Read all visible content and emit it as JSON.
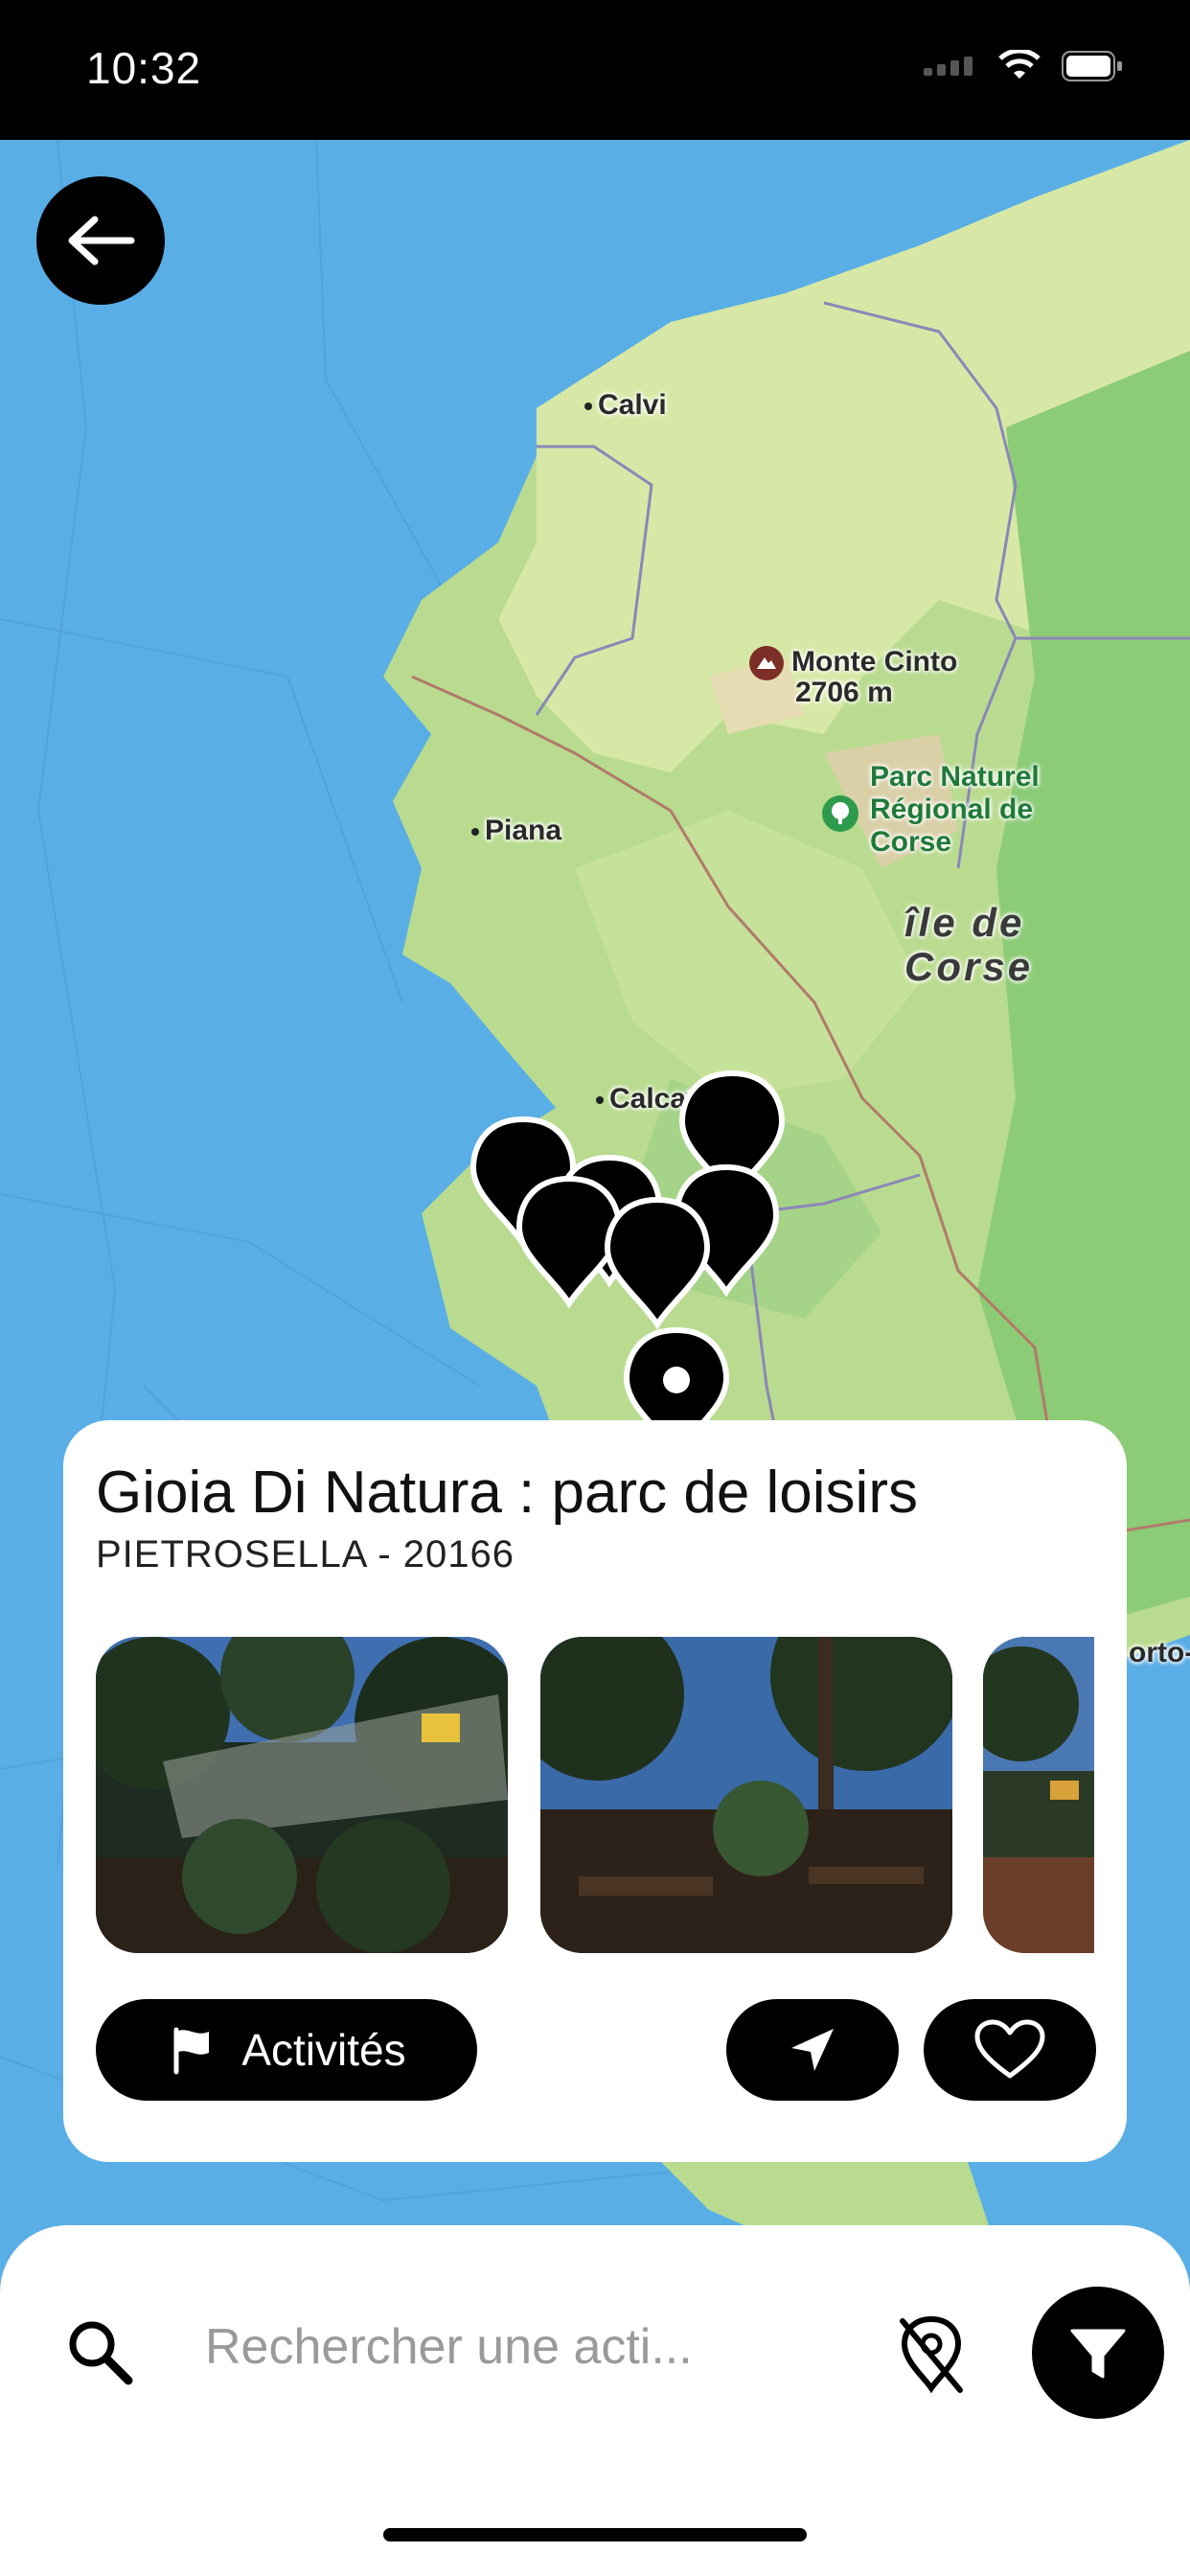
{
  "status_bar": {
    "time": "10:32"
  },
  "map": {
    "labels": {
      "calvi": "Calvi",
      "monte_cinto": "Monte Cinto",
      "monte_cinto_alt": "2706 m",
      "parc_line1": "Parc Naturel",
      "parc_line2": "Régional de",
      "parc_line3": "Corse",
      "piana": "Piana",
      "ile_line1": "île de",
      "ile_line2": "Corse",
      "calcatoggio": "Calcatoggio",
      "porto": "orto-"
    }
  },
  "card": {
    "title": "Gioia Di Natura : parc de loisirs",
    "subtitle": "PIETROSELLA - 20166",
    "activities_label": "Activités"
  },
  "search": {
    "placeholder": "Rechercher une acti..."
  },
  "icons": {
    "back": "arrow-left-icon",
    "search": "search-icon",
    "location_off": "location-off-icon",
    "filter": "filter-icon",
    "directions": "navigation-arrow-icon",
    "favorite": "heart-icon",
    "activities": "flag-icon"
  },
  "colors": {
    "water": "#5aaee6",
    "land_light": "#d8e8a8",
    "land_green": "#a9d58c",
    "accent": "#000000"
  }
}
